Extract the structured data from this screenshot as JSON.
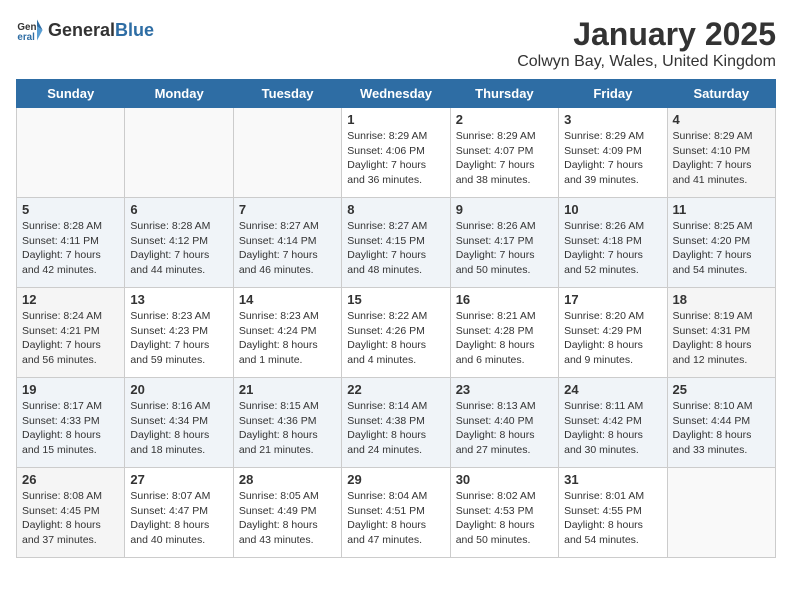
{
  "logo": {
    "general": "General",
    "blue": "Blue"
  },
  "title": "January 2025",
  "subtitle": "Colwyn Bay, Wales, United Kingdom",
  "days_of_week": [
    "Sunday",
    "Monday",
    "Tuesday",
    "Wednesday",
    "Thursday",
    "Friday",
    "Saturday"
  ],
  "weeks": [
    {
      "days": [
        {
          "num": "",
          "info": ""
        },
        {
          "num": "",
          "info": ""
        },
        {
          "num": "",
          "info": ""
        },
        {
          "num": "1",
          "info": "Sunrise: 8:29 AM\nSunset: 4:06 PM\nDaylight: 7 hours and 36 minutes."
        },
        {
          "num": "2",
          "info": "Sunrise: 8:29 AM\nSunset: 4:07 PM\nDaylight: 7 hours and 38 minutes."
        },
        {
          "num": "3",
          "info": "Sunrise: 8:29 AM\nSunset: 4:09 PM\nDaylight: 7 hours and 39 minutes."
        },
        {
          "num": "4",
          "info": "Sunrise: 8:29 AM\nSunset: 4:10 PM\nDaylight: 7 hours and 41 minutes."
        }
      ]
    },
    {
      "days": [
        {
          "num": "5",
          "info": "Sunrise: 8:28 AM\nSunset: 4:11 PM\nDaylight: 7 hours and 42 minutes."
        },
        {
          "num": "6",
          "info": "Sunrise: 8:28 AM\nSunset: 4:12 PM\nDaylight: 7 hours and 44 minutes."
        },
        {
          "num": "7",
          "info": "Sunrise: 8:27 AM\nSunset: 4:14 PM\nDaylight: 7 hours and 46 minutes."
        },
        {
          "num": "8",
          "info": "Sunrise: 8:27 AM\nSunset: 4:15 PM\nDaylight: 7 hours and 48 minutes."
        },
        {
          "num": "9",
          "info": "Sunrise: 8:26 AM\nSunset: 4:17 PM\nDaylight: 7 hours and 50 minutes."
        },
        {
          "num": "10",
          "info": "Sunrise: 8:26 AM\nSunset: 4:18 PM\nDaylight: 7 hours and 52 minutes."
        },
        {
          "num": "11",
          "info": "Sunrise: 8:25 AM\nSunset: 4:20 PM\nDaylight: 7 hours and 54 minutes."
        }
      ]
    },
    {
      "days": [
        {
          "num": "12",
          "info": "Sunrise: 8:24 AM\nSunset: 4:21 PM\nDaylight: 7 hours and 56 minutes."
        },
        {
          "num": "13",
          "info": "Sunrise: 8:23 AM\nSunset: 4:23 PM\nDaylight: 7 hours and 59 minutes."
        },
        {
          "num": "14",
          "info": "Sunrise: 8:23 AM\nSunset: 4:24 PM\nDaylight: 8 hours and 1 minute."
        },
        {
          "num": "15",
          "info": "Sunrise: 8:22 AM\nSunset: 4:26 PM\nDaylight: 8 hours and 4 minutes."
        },
        {
          "num": "16",
          "info": "Sunrise: 8:21 AM\nSunset: 4:28 PM\nDaylight: 8 hours and 6 minutes."
        },
        {
          "num": "17",
          "info": "Sunrise: 8:20 AM\nSunset: 4:29 PM\nDaylight: 8 hours and 9 minutes."
        },
        {
          "num": "18",
          "info": "Sunrise: 8:19 AM\nSunset: 4:31 PM\nDaylight: 8 hours and 12 minutes."
        }
      ]
    },
    {
      "days": [
        {
          "num": "19",
          "info": "Sunrise: 8:17 AM\nSunset: 4:33 PM\nDaylight: 8 hours and 15 minutes."
        },
        {
          "num": "20",
          "info": "Sunrise: 8:16 AM\nSunset: 4:34 PM\nDaylight: 8 hours and 18 minutes."
        },
        {
          "num": "21",
          "info": "Sunrise: 8:15 AM\nSunset: 4:36 PM\nDaylight: 8 hours and 21 minutes."
        },
        {
          "num": "22",
          "info": "Sunrise: 8:14 AM\nSunset: 4:38 PM\nDaylight: 8 hours and 24 minutes."
        },
        {
          "num": "23",
          "info": "Sunrise: 8:13 AM\nSunset: 4:40 PM\nDaylight: 8 hours and 27 minutes."
        },
        {
          "num": "24",
          "info": "Sunrise: 8:11 AM\nSunset: 4:42 PM\nDaylight: 8 hours and 30 minutes."
        },
        {
          "num": "25",
          "info": "Sunrise: 8:10 AM\nSunset: 4:44 PM\nDaylight: 8 hours and 33 minutes."
        }
      ]
    },
    {
      "days": [
        {
          "num": "26",
          "info": "Sunrise: 8:08 AM\nSunset: 4:45 PM\nDaylight: 8 hours and 37 minutes."
        },
        {
          "num": "27",
          "info": "Sunrise: 8:07 AM\nSunset: 4:47 PM\nDaylight: 8 hours and 40 minutes."
        },
        {
          "num": "28",
          "info": "Sunrise: 8:05 AM\nSunset: 4:49 PM\nDaylight: 8 hours and 43 minutes."
        },
        {
          "num": "29",
          "info": "Sunrise: 8:04 AM\nSunset: 4:51 PM\nDaylight: 8 hours and 47 minutes."
        },
        {
          "num": "30",
          "info": "Sunrise: 8:02 AM\nSunset: 4:53 PM\nDaylight: 8 hours and 50 minutes."
        },
        {
          "num": "31",
          "info": "Sunrise: 8:01 AM\nSunset: 4:55 PM\nDaylight: 8 hours and 54 minutes."
        },
        {
          "num": "",
          "info": ""
        }
      ]
    }
  ]
}
